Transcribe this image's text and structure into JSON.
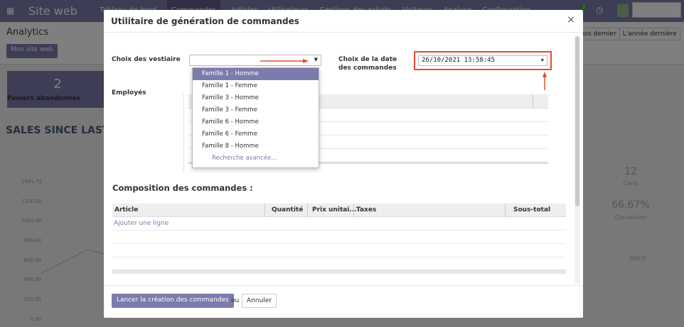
{
  "app": {
    "brand": "Site web",
    "menu": [
      "Tableau de bord",
      "Commandes",
      "Articles",
      "Utilisateurs",
      "Gestions des achats",
      "Visiteurs",
      "Analyse",
      "Configuration"
    ],
    "chat_count": "2"
  },
  "subbar": {
    "title": "Analytics",
    "site_button": "Mon site web",
    "filter_last_month": "ois dernier",
    "filter_last_year": "L'année dernière"
  },
  "kpi": {
    "value": "2",
    "label": "Paniers abandonnés"
  },
  "sales_title": "SALES SINCE LAST W",
  "yaxis": [
    "1401.75",
    "1200.00",
    "1000.00",
    "800.00",
    "600.00",
    "400.00",
    "200.00",
    "0.00"
  ],
  "right_stats": {
    "value1": "12",
    "label1": "Carts",
    "value2": "66.67%",
    "label2": "Conversion",
    "value3": "000.0"
  },
  "modal": {
    "title": "Utilitaire de génération de commandes",
    "close": "×",
    "vestiaire_label": "Choix des vestiaire",
    "date_label": "Choix de la date des commandes",
    "date_value": "26/10/2021 13:58:45",
    "employes_label": "Employés",
    "dropdown_options": [
      "Famille 1 - Homme",
      "Famille 1 - Femme",
      "Famille 3 - Homme",
      "Famille 3 - Femme",
      "Famille 6 - Homme",
      "Famille 6 - Femme",
      "Famille 8 - Homme"
    ],
    "dropdown_advanced": "Recherche avancée...",
    "composition_title": "Composition des commandes :",
    "columns": {
      "article": "Article",
      "quantite": "Quantité",
      "prix": "Prix unitai...",
      "taxes": "Taxes",
      "sous_total": "Sous-total"
    },
    "add_line": "Ajouter une ligne",
    "submit": "Lancer la création des commandes",
    "or": "ou",
    "cancel": "Annuler"
  },
  "colors": {
    "primary": "#7c7bad",
    "annotation": "#e84a2e"
  }
}
